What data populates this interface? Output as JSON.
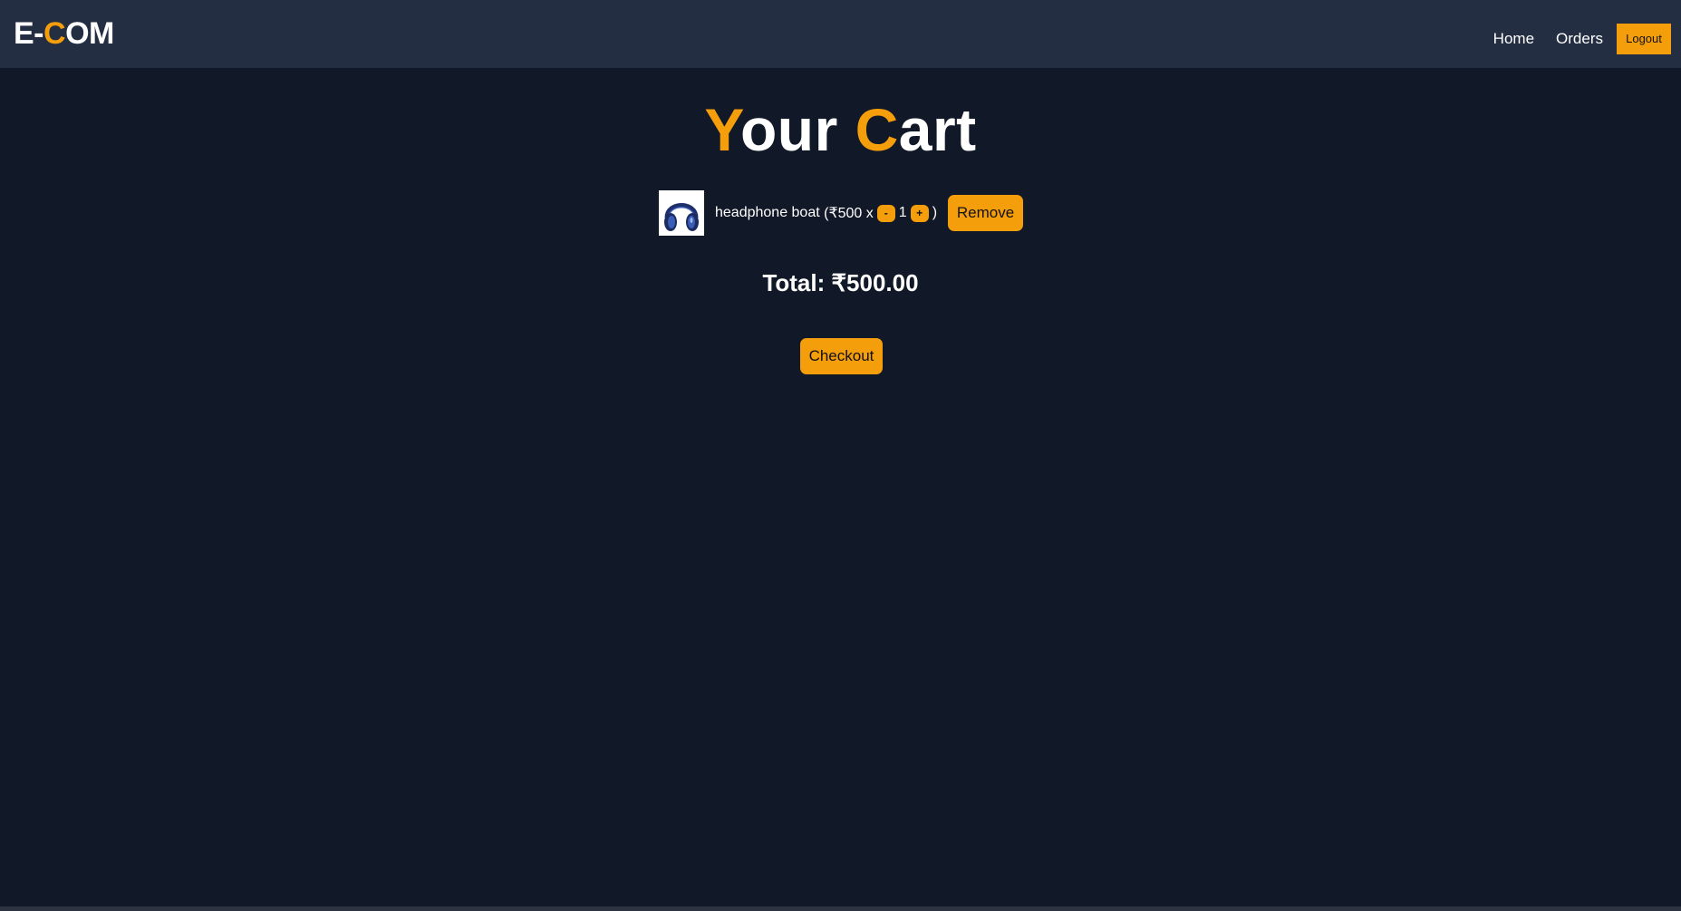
{
  "navbar": {
    "brand_part1": "E-",
    "brand_accent": "C",
    "brand_part2": "OM",
    "links": {
      "home": "Home",
      "orders": "Orders"
    },
    "logout_label": "Logout"
  },
  "cart": {
    "title_accent1": "Y",
    "title_rest1": "our ",
    "title_accent2": "C",
    "title_rest2": "art",
    "item": {
      "name": "headphone boat",
      "price_prefix": "(₹500 x",
      "decrement_label": "-",
      "quantity": "1",
      "increment_label": "+",
      "close_paren": ")",
      "image_icon": "headphones-icon",
      "remove_label": "Remove"
    },
    "total_text": "Total: ₹500.00",
    "checkout_label": "Checkout"
  },
  "colors": {
    "accent": "#f59e0b",
    "background": "#111827",
    "navbar": "#232e42"
  }
}
